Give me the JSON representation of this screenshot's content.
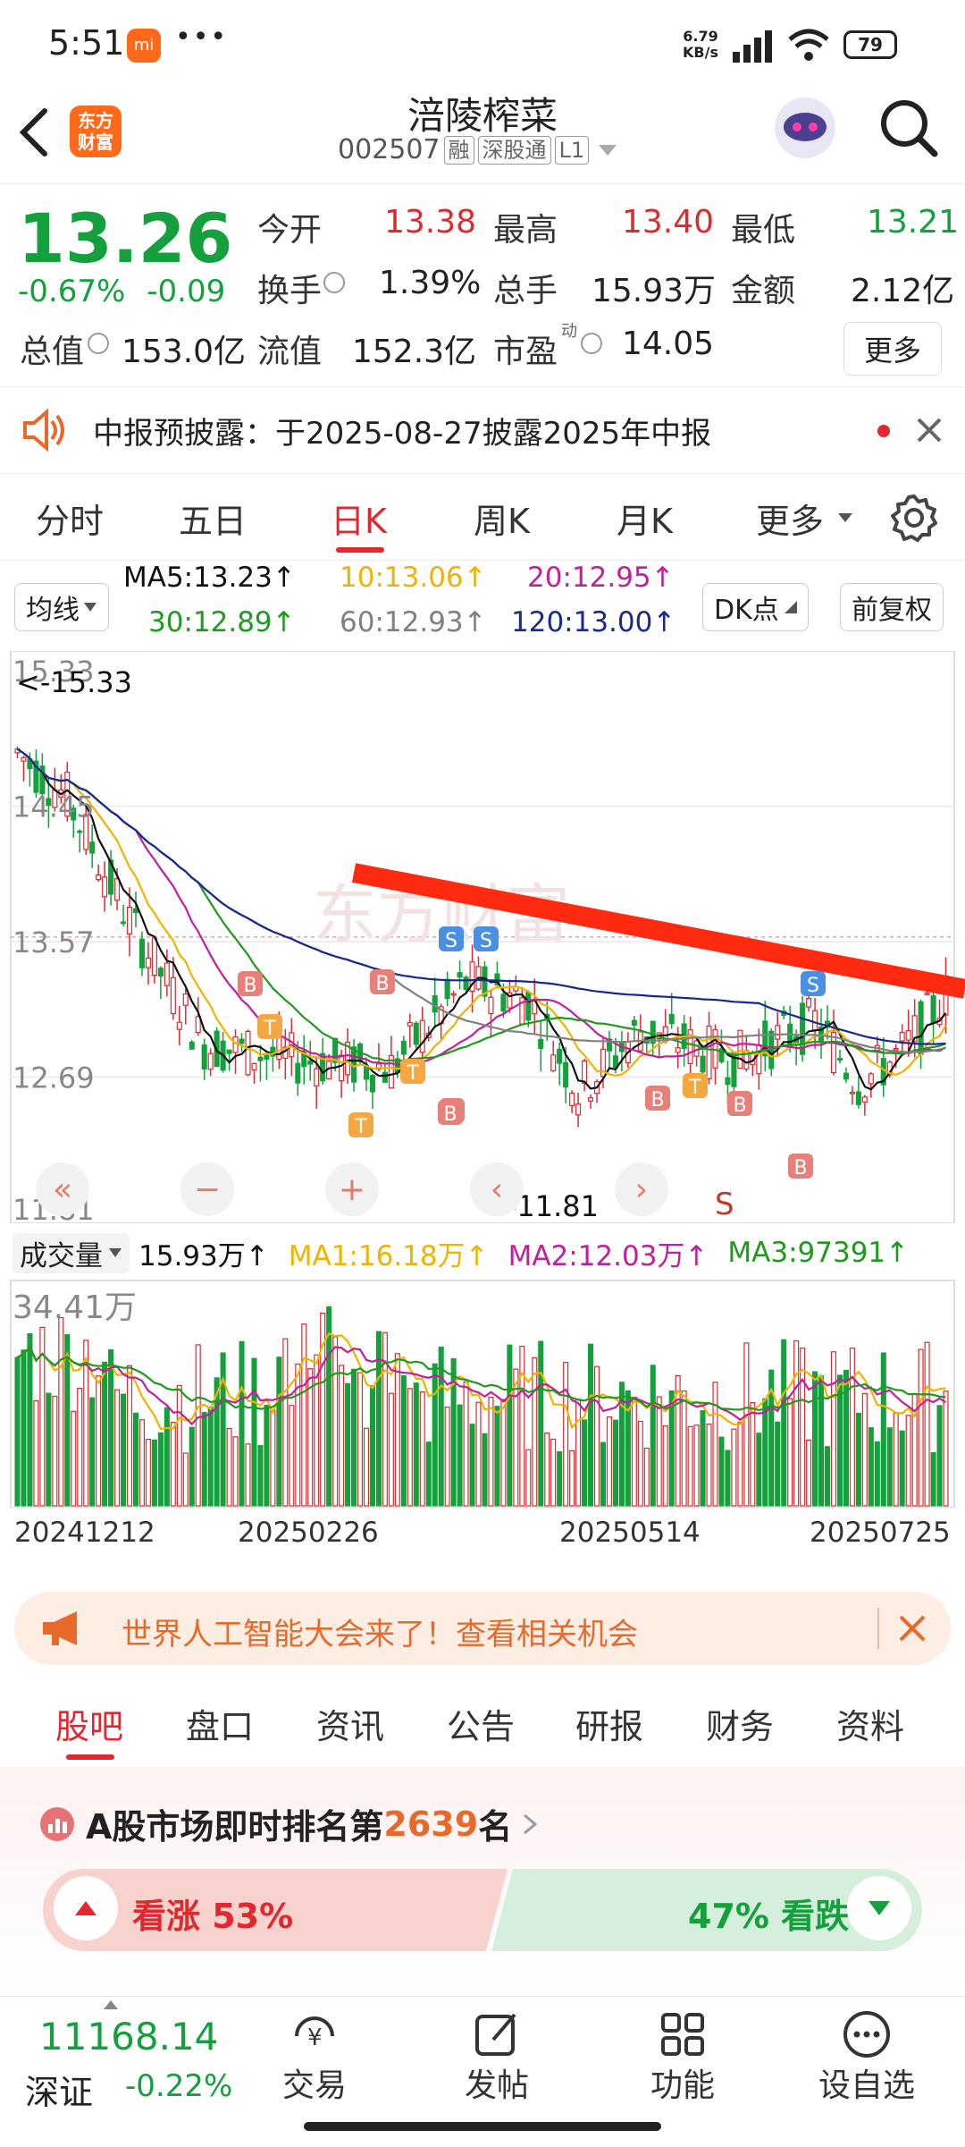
{
  "status": {
    "time": "5:51",
    "mi": "mi",
    "dots": "•••",
    "net_speed": "6.79",
    "net_unit": "KB/s",
    "battery": "79"
  },
  "header": {
    "logo_line1": "东方",
    "logo_line2": "财富",
    "name": "涪陵榨菜",
    "code": "002507",
    "badges": [
      "融",
      "深股通",
      "L1"
    ]
  },
  "quote": {
    "price": "13.26",
    "change_pct": "-0.67%",
    "change_abs": "-0.09",
    "rows": [
      [
        {
          "l": "今开",
          "v": "13.38",
          "c": "red"
        },
        {
          "l": "最高",
          "v": "13.40",
          "c": "red"
        },
        {
          "l": "最低",
          "v": "13.21",
          "c": "green"
        }
      ],
      [
        {
          "l": "换手",
          "v": "1.39%",
          "c": "dark"
        },
        {
          "l": "总手",
          "v": "15.93万",
          "c": "dark"
        },
        {
          "l": "金额",
          "v": "2.12亿",
          "c": "dark"
        }
      ]
    ],
    "row3": {
      "zz_label": "总值",
      "zz_val": "153.0亿",
      "lz_label": "流值",
      "lz_val": "152.3亿",
      "sy_label": "市盈",
      "sy_sup": "动",
      "sy_val": "14.05",
      "more": "更多"
    }
  },
  "notice": {
    "text": "中报预披露：于2025-08-27披露2025年中报"
  },
  "chart_tabs": [
    "分时",
    "五日",
    "日K",
    "周K",
    "月K",
    "更多"
  ],
  "active_tab": 2,
  "ma_bar": {
    "selector": "均线",
    "dk": "DK点",
    "fq": "前复权",
    "ma5": "MA5:13.23↑",
    "ma10": "10:13.06↑",
    "ma20": "20:12.95↑",
    "ma30": "30:12.89↑",
    "ma60": "60:12.93↑",
    "ma120": "120:13.00↑"
  },
  "chart_data": {
    "type": "candlestick",
    "y_ticks": [
      "15.33",
      "14.45",
      "13.57",
      "12.69",
      "11.81"
    ],
    "high_marker": "<-15.33",
    "low_marker": "<-11.81",
    "x_labels": [
      "20241212",
      "20250226",
      "20250514",
      "20250725"
    ],
    "signal_markers": [
      "B",
      "B",
      "T",
      "T",
      "T",
      "B",
      "S",
      "S",
      "B",
      "B",
      "T",
      "B",
      "S",
      "B"
    ],
    "volume": {
      "selector": "成交量",
      "value": "15.93万↑",
      "ma1": "MA1:16.18万↑",
      "ma2": "MA2:12.03万↑",
      "ma3": "MA3:97391↑",
      "max_label": "34.41万"
    },
    "nav_buttons": [
      "«",
      "−",
      "+",
      "‹",
      "›"
    ],
    "s_label": "S"
  },
  "colors": {
    "red": "#e0292f",
    "green": "#14a03c",
    "ma5": "#111111",
    "ma10": "#f0b400",
    "ma20": "#c0209a",
    "ma30": "#1f9a1f",
    "ma60": "#808080",
    "ma120": "#1a2a8a",
    "trend": "#ff2a10"
  },
  "promo": {
    "text": "世界人工智能大会来了！查看相关机会"
  },
  "bottom_tabs": [
    "股吧",
    "盘口",
    "资讯",
    "公告",
    "研报",
    "财务",
    "资料"
  ],
  "rank": {
    "prefix": "A股市场即时排名第",
    "num": "2639",
    "suffix": "名"
  },
  "sentiment": {
    "up": "看涨 53%",
    "down": "47% 看跌"
  },
  "footer": {
    "index": "11168.14",
    "index_name": "深证",
    "index_chg": "-0.22%",
    "nav": [
      "交易",
      "发帖",
      "功能",
      "设自选"
    ]
  }
}
